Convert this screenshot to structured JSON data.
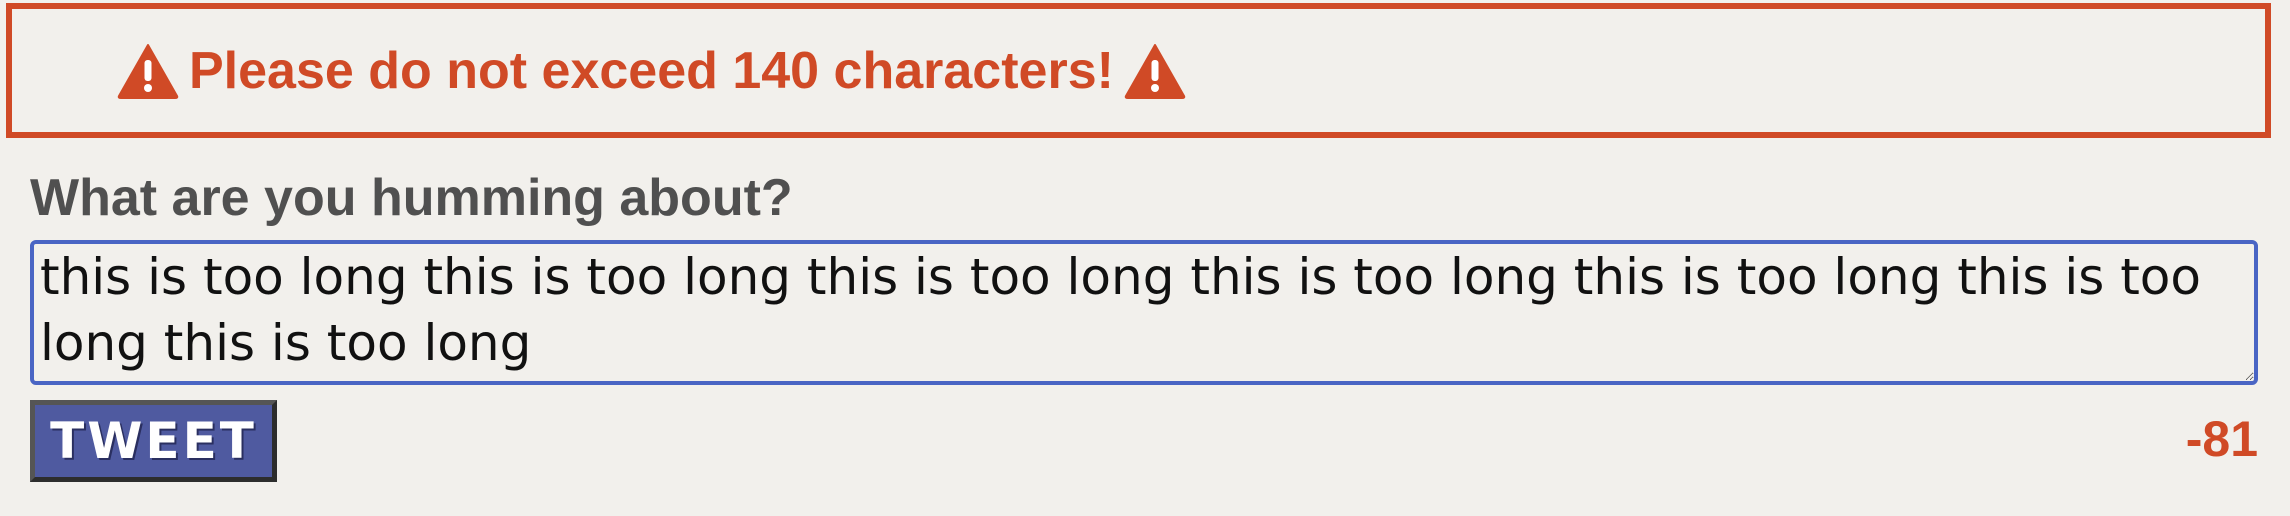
{
  "alert": {
    "message": "Please do not exceed 140 characters!",
    "icon": "warning-icon",
    "color": "#d04a26"
  },
  "composer": {
    "label": "What are you humming about?",
    "value": "this is too long this is too long this is too long this is too long this is too long this is too long this is too long",
    "submit_label": "TWEET",
    "remaining_count": "-81",
    "accent_color": "#4a65c4",
    "button_color": "#4f5aa0"
  }
}
